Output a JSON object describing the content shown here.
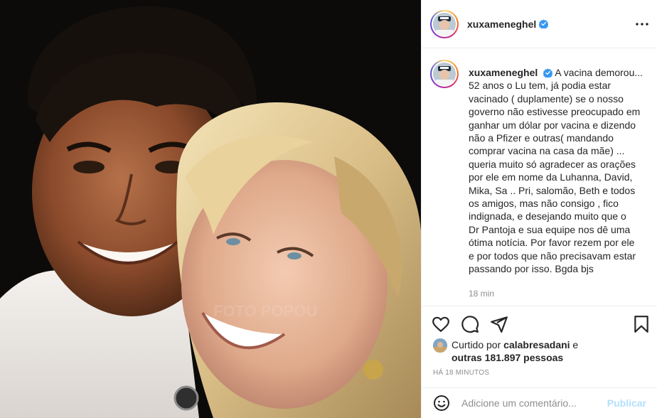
{
  "post": {
    "username": "xuxameneghel",
    "caption_user": "xuxameneghel",
    "caption_text": "A vacina demorou...\n52 anos o Lu tem, já podia estar\nvacinado ( duplamente) se o nosso\ngoverno não estivesse preocupado em\nganhar um dólar por vacina e dizendo\nnão a Pfizer e outras( mandando\ncomprar vacina na casa da mãe) ...\nqueria muito só agradecer as orações\npor ele em nome da Luhanna, David,\nMika, Sa .. Pri, salomão, Beth e todos\nos amigos, mas não consigo , fico\nindignada, e desejando muito que o\nDr Pantoja e sua equipe nos dê uma\nótima notícia. Por favor rezem por ele\ne por todos que não precisavam estar\npassando por isso. Bgda bjs",
    "caption_age": "18 min",
    "watermark": "FOTO POPOU"
  },
  "likes": {
    "prefix": "Curtido por ",
    "user": "calabresadani",
    "mid": " e",
    "others_label": "outras 181.897 pessoas"
  },
  "post_time": "HÁ 18 MINUTOS",
  "comment": {
    "placeholder": "Adicione um comentário...",
    "publish_label": "Publicar"
  },
  "icons": {
    "header": [
      "verified-badge-icon",
      "more-options-icon"
    ],
    "actions": [
      "heart-icon",
      "comment-icon",
      "share-icon",
      "bookmark-icon"
    ],
    "comment_bar": [
      "emoji-icon"
    ]
  },
  "colors": {
    "verified": "#3897f0",
    "publish_disabled": "#b2dffc",
    "muted": "#8e8e8e",
    "border": "#efefef"
  }
}
